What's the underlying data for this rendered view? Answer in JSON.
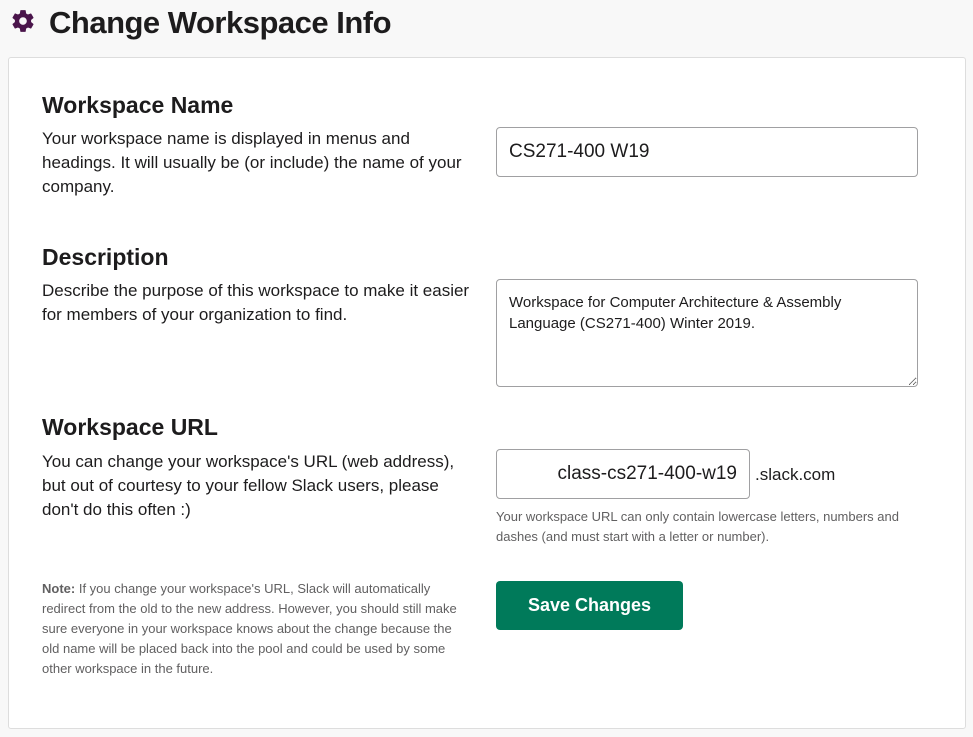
{
  "header": {
    "title": "Change Workspace Info",
    "icon": "gear-icon",
    "icon_color": "#4a154b"
  },
  "sections": {
    "name": {
      "title": "Workspace Name",
      "description": "Your workspace name is displayed in menus and headings. It will usually be (or include) the name of your company.",
      "value": "CS271-400 W19"
    },
    "description": {
      "title": "Description",
      "description": "Describe the purpose of this workspace to make it easier for members of your organization to find.",
      "value": "Workspace for Computer Architecture & Assembly Language (CS271-400) Winter 2019."
    },
    "url": {
      "title": "Workspace URL",
      "description": "You can change your workspace's URL (web address), but out of courtesy to your fellow Slack users, please don't do this often :)",
      "value": "class-cs271-400-w19",
      "suffix": ".slack.com",
      "hint": "Your workspace URL can only contain lowercase letters, numbers and dashes (and must start with a letter or number)."
    }
  },
  "note": {
    "label": "Note:",
    "text": " If you change your workspace's URL, Slack will automatically redirect from the old to the new address. However, you should still make sure everyone in your workspace knows about the change because the old name will be placed back into the pool and could be used by some other workspace in the future."
  },
  "actions": {
    "save_label": "Save Changes",
    "save_color": "#007a5a"
  }
}
